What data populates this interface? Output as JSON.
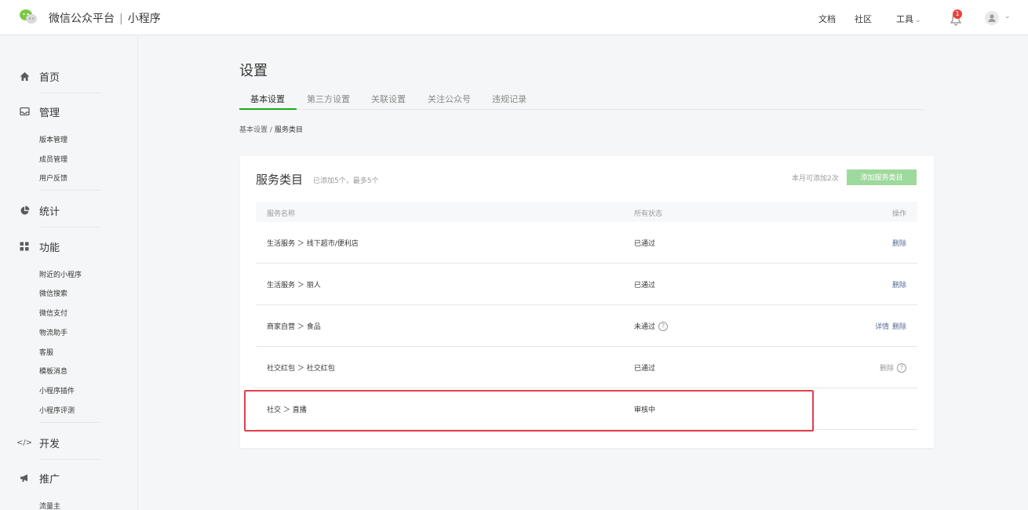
{
  "header": {
    "brand_name": "微信公众平台",
    "brand_sep": "|",
    "brand_product": "小程序",
    "docs": "文档",
    "community": "社区",
    "tools": "工具",
    "notification_count": "1"
  },
  "sidebar": {
    "home": "首页",
    "manage": "管理",
    "manage_items": [
      "版本管理",
      "成员管理",
      "用户反馈"
    ],
    "stats": "统计",
    "features": "功能",
    "feature_items": [
      "附近的小程序",
      "微信搜索",
      "微信支付",
      "物流助手",
      "客服",
      "模板消息",
      "小程序插件",
      "小程序评测"
    ],
    "develop": "开发",
    "promote": "推广",
    "promote_items": [
      "流量主"
    ]
  },
  "main": {
    "title": "设置",
    "tabs": [
      "基本设置",
      "第三方设置",
      "关联设置",
      "关注公众号",
      "违规记录"
    ],
    "breadcrumb_parent": "基本设置",
    "breadcrumb_sep": "/",
    "breadcrumb_current": "服务类目"
  },
  "card": {
    "title": "服务类目",
    "hint": "已添加5个，最多5个",
    "month_hint": "本月可添加2次",
    "add_button": "添加服务类目"
  },
  "table": {
    "headers": [
      "服务名称",
      "所有状态",
      "操作"
    ],
    "rows": [
      {
        "name": "生活服务 ＞ 线下超市/便利店",
        "status": "已通过",
        "op1": "删除"
      },
      {
        "name": "生活服务 ＞ 丽人",
        "status": "已通过",
        "op1": "删除"
      },
      {
        "name": "商家自营 ＞ 食品",
        "status": "未通过",
        "op1": "详情",
        "op2": "删除"
      },
      {
        "name": "社交红包 ＞ 社交红包",
        "status": "已通过",
        "op1": "删除"
      },
      {
        "name": "社交 ＞ 直播",
        "status": "审核中"
      }
    ]
  },
  "colors": {
    "accent_green": "#1aad19",
    "link_blue": "#576b95",
    "highlight_red": "#e0414b"
  }
}
